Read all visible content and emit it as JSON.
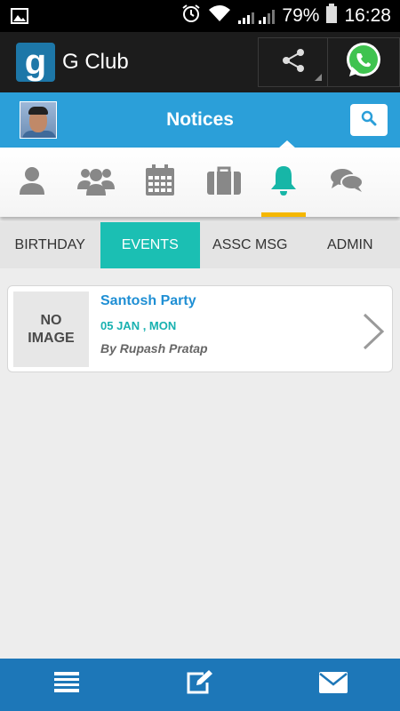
{
  "status_bar": {
    "battery": "79%",
    "time": "16:28",
    "icons": [
      "image-icon",
      "alarm-icon",
      "wifi-icon",
      "signal-icon",
      "battery-icon"
    ]
  },
  "app_bar": {
    "logo_letter": "g",
    "title": "G Club",
    "icons": [
      "share-icon",
      "whatsapp-icon"
    ]
  },
  "header": {
    "title": "Notices",
    "icons": [
      "avatar",
      "search-icon"
    ]
  },
  "icon_tabs": [
    {
      "icon": "user-icon",
      "active": false
    },
    {
      "icon": "group-icon",
      "active": false
    },
    {
      "icon": "calendar-icon",
      "active": false
    },
    {
      "icon": "briefcase-icon",
      "active": false
    },
    {
      "icon": "bell-icon",
      "active": true
    },
    {
      "icon": "chat-icon",
      "active": false
    }
  ],
  "text_tabs": [
    {
      "label": "BIRTHDAY",
      "active": false
    },
    {
      "label": "EVENTS",
      "active": true
    },
    {
      "label": "ASSC MSG",
      "active": false
    },
    {
      "label": "ADMIN",
      "active": false
    }
  ],
  "events": [
    {
      "image_placeholder_line1": "NO",
      "image_placeholder_line2": "IMAGE",
      "title": "Santosh Party",
      "date": "05 JAN , MON",
      "author": "By Rupash Pratap"
    }
  ],
  "bottom_bar": {
    "icons": [
      "list-icon",
      "edit-icon",
      "mail-icon"
    ]
  },
  "colors": {
    "accent_blue": "#2b9fd9",
    "tab_teal": "#1bbfb3",
    "active_underline": "#f5b700",
    "bottom_bar": "#1d77b8",
    "title_blue": "#1f8fd4"
  }
}
